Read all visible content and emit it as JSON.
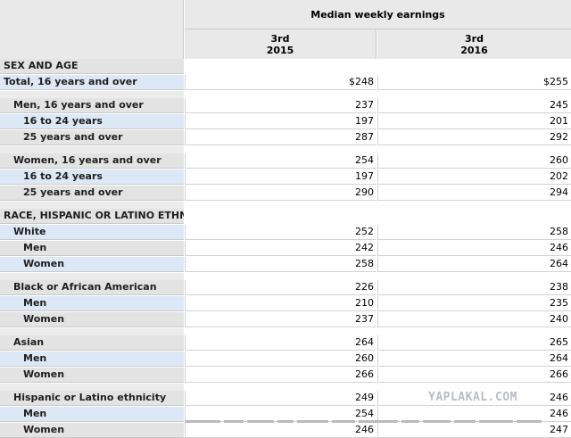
{
  "table": {
    "header_title": "Median weekly earnings",
    "columns": [
      {
        "line1": "3rd",
        "line2": "2015"
      },
      {
        "line1": "3rd",
        "line2": "2016"
      }
    ],
    "rows": [
      {
        "label": "SEX AND AGE",
        "indent": 0,
        "section": true,
        "values": []
      },
      {
        "label": "Total, 16 years and over",
        "indent": 0,
        "highlight": true,
        "values": [
          "$248",
          "$255"
        ]
      },
      {
        "gap": true
      },
      {
        "label": "Men, 16 years and over",
        "indent": 1,
        "values": [
          "237",
          "245"
        ]
      },
      {
        "label": "16 to 24 years",
        "indent": 2,
        "highlight": true,
        "values": [
          "197",
          "201"
        ]
      },
      {
        "label": "25 years and over",
        "indent": 2,
        "values": [
          "287",
          "292"
        ]
      },
      {
        "gap": true
      },
      {
        "label": "Women, 16 years and over",
        "indent": 1,
        "values": [
          "254",
          "260"
        ]
      },
      {
        "label": "16 to 24 years",
        "indent": 2,
        "highlight": true,
        "values": [
          "197",
          "202"
        ]
      },
      {
        "label": "25 years and over",
        "indent": 2,
        "values": [
          "290",
          "294"
        ]
      },
      {
        "gap": true
      },
      {
        "label": "RACE, HISPANIC OR LATINO ETHNIC",
        "indent": 0,
        "section": true,
        "values": []
      },
      {
        "label": "White",
        "indent": 1,
        "highlight": true,
        "values": [
          "252",
          "258"
        ]
      },
      {
        "label": "Men",
        "indent": 2,
        "values": [
          "242",
          "246"
        ]
      },
      {
        "label": "Women",
        "indent": 2,
        "highlight": true,
        "values": [
          "258",
          "264"
        ]
      },
      {
        "gap": true
      },
      {
        "label": "Black or African American",
        "indent": 1,
        "values": [
          "226",
          "238"
        ]
      },
      {
        "label": "Men",
        "indent": 2,
        "highlight": true,
        "values": [
          "210",
          "235"
        ]
      },
      {
        "label": "Women",
        "indent": 2,
        "values": [
          "237",
          "240"
        ]
      },
      {
        "gap": true
      },
      {
        "label": "Asian",
        "indent": 1,
        "values": [
          "264",
          "265"
        ]
      },
      {
        "label": "Men",
        "indent": 2,
        "highlight": true,
        "values": [
          "260",
          "264"
        ]
      },
      {
        "label": "Women",
        "indent": 2,
        "values": [
          "266",
          "266"
        ]
      },
      {
        "gap": true
      },
      {
        "label": "Hispanic or Latino ethnicity",
        "indent": 1,
        "values": [
          "249",
          "246"
        ]
      },
      {
        "label": "Men",
        "indent": 2,
        "highlight": true,
        "values": [
          "254",
          "246"
        ]
      },
      {
        "label": "Women",
        "indent": 2,
        "values": [
          "246",
          "247"
        ]
      }
    ]
  },
  "watermark": "YAPLAKAL.COM",
  "colors": {
    "header_bg": "#e9e9e9",
    "label_bg": "#e3e3e3",
    "highlight_bg": "#dde8f6",
    "value_bg": "#ffffff"
  }
}
